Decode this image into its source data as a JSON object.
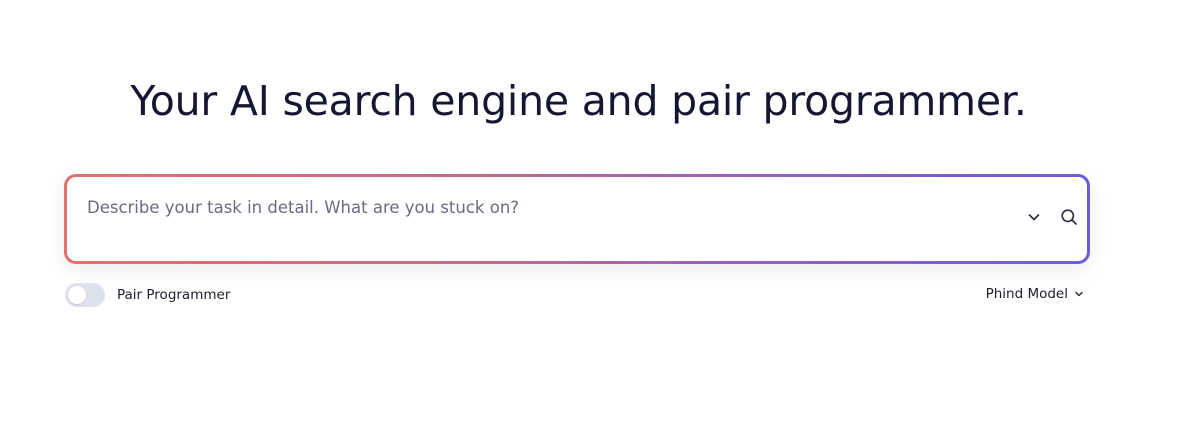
{
  "hero": {
    "title": "Your AI search engine and pair programmer."
  },
  "search": {
    "placeholder": "Describe your task in detail. What are you stuck on?",
    "value": "",
    "icons": {
      "expand": "chevron-down-icon",
      "submit": "search-icon"
    },
    "gradient_colors": [
      "#e0706a",
      "#c86a88",
      "#9a5fc4",
      "#6a5ed6"
    ]
  },
  "options": {
    "pair_programmer": {
      "label": "Pair Programmer",
      "enabled": false
    },
    "model": {
      "selected": "Phind Model",
      "icon": "chevron-down-icon"
    }
  },
  "colors": {
    "title": "#161633",
    "toggle_off": "#dfe1ef"
  }
}
